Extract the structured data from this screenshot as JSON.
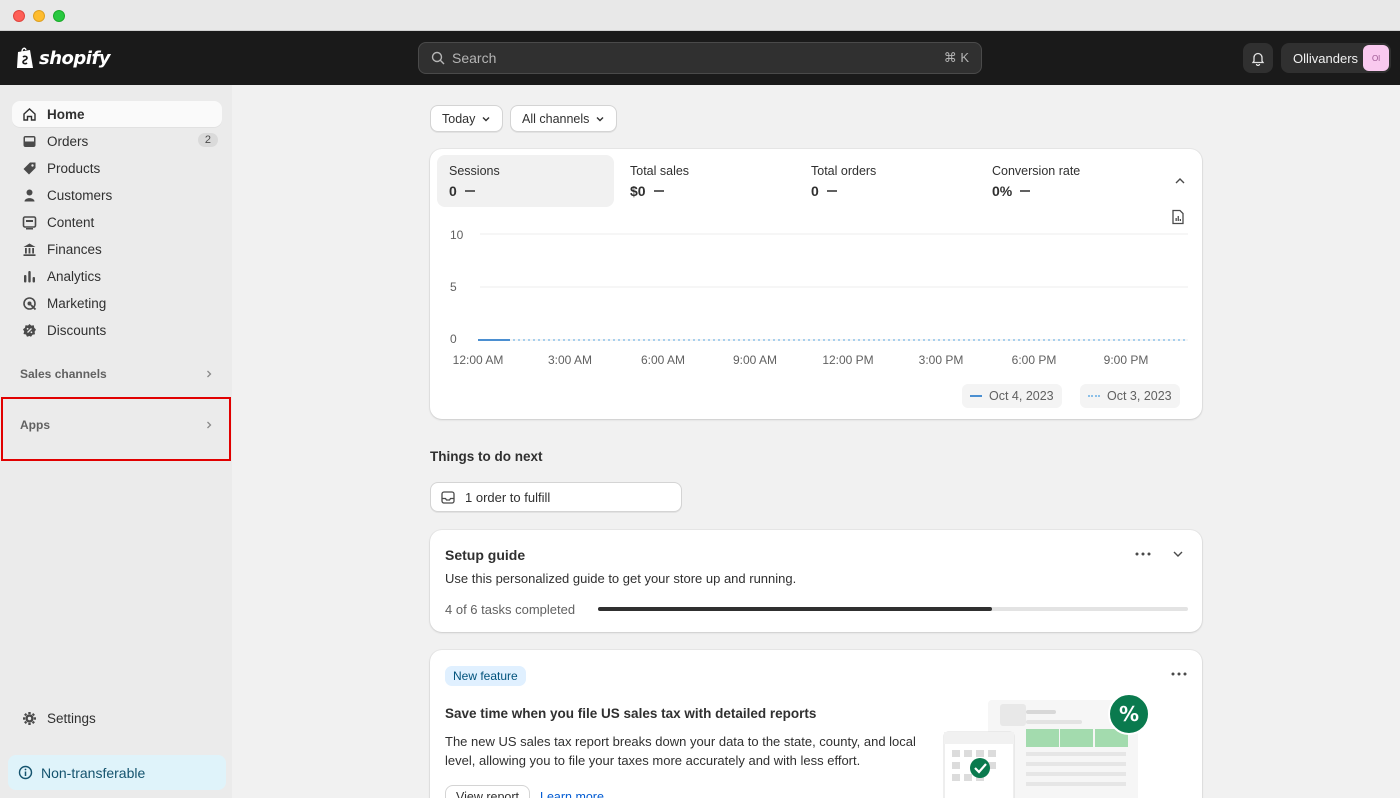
{
  "brand": {
    "name": "shopify"
  },
  "search": {
    "placeholder": "Search",
    "shortcut": "⌘ K"
  },
  "store": {
    "name": "Ollivanders",
    "initials": "Ol"
  },
  "sidebar": {
    "items": [
      {
        "label": "Home",
        "icon": "home-icon"
      },
      {
        "label": "Orders",
        "icon": "inbox-icon",
        "badge": "2"
      },
      {
        "label": "Products",
        "icon": "tag-icon"
      },
      {
        "label": "Customers",
        "icon": "person-icon"
      },
      {
        "label": "Content",
        "icon": "content-icon"
      },
      {
        "label": "Finances",
        "icon": "bank-icon"
      },
      {
        "label": "Analytics",
        "icon": "bar-chart-icon"
      },
      {
        "label": "Marketing",
        "icon": "target-icon"
      },
      {
        "label": "Discounts",
        "icon": "discount-icon"
      }
    ],
    "sales_channels": "Sales channels",
    "apps": "Apps",
    "settings": "Settings",
    "nontransferable": "Non-transferable"
  },
  "filters": {
    "date": "Today",
    "channels": "All channels"
  },
  "metrics": [
    {
      "label": "Sessions",
      "value": "0"
    },
    {
      "label": "Total sales",
      "value": "$0"
    },
    {
      "label": "Total orders",
      "value": "0"
    },
    {
      "label": "Conversion rate",
      "value": "0%"
    }
  ],
  "chart_data": {
    "type": "line",
    "x": [
      "12:00 AM",
      "3:00 AM",
      "6:00 AM",
      "9:00 AM",
      "12:00 PM",
      "3:00 PM",
      "6:00 PM",
      "9:00 PM"
    ],
    "yticks": [
      "10",
      "5",
      "0"
    ],
    "ylim": [
      0,
      10
    ],
    "series": [
      {
        "name": "Oct 4, 2023",
        "values": [
          0
        ],
        "style": "solid",
        "color": "#4b8fd1"
      },
      {
        "name": "Oct 3, 2023",
        "values": [
          0,
          0,
          0,
          0,
          0,
          0,
          0,
          0
        ],
        "style": "dotted",
        "color": "#8cc0e8"
      }
    ],
    "grid": true
  },
  "things": {
    "title": "Things to do next",
    "fulfill": "1 order to fulfill"
  },
  "setup": {
    "title": "Setup guide",
    "description": "Use this personalized guide to get your store up and running.",
    "progress_label": "4 of 6 tasks completed",
    "progress_fraction": 0.667
  },
  "new_feature": {
    "badge": "New feature",
    "title": "Save time when you file US sales tax with detailed reports",
    "body": "The new US sales tax report breaks down your data to the state, county, and local level, allowing you to file your taxes more accurately and with less effort.",
    "button": "View report",
    "link": "Learn more"
  },
  "colors": {
    "accent": "#1a1a1a",
    "highlight": "#e10000",
    "info_bg": "#dff3fa",
    "feature_green": "#0a7a4e"
  }
}
